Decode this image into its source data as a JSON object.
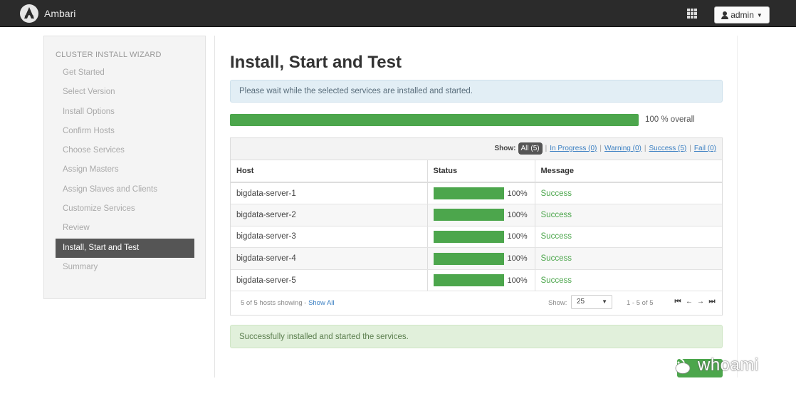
{
  "navbar": {
    "app_name": "Ambari",
    "user_label": "admin"
  },
  "sidebar": {
    "title": "CLUSTER INSTALL WIZARD",
    "items": [
      {
        "label": "Get Started"
      },
      {
        "label": "Select Version"
      },
      {
        "label": "Install Options"
      },
      {
        "label": "Confirm Hosts"
      },
      {
        "label": "Choose Services"
      },
      {
        "label": "Assign Masters"
      },
      {
        "label": "Assign Slaves and Clients"
      },
      {
        "label": "Customize Services"
      },
      {
        "label": "Review"
      },
      {
        "label": "Install, Start and Test",
        "active": true
      },
      {
        "label": "Summary"
      }
    ]
  },
  "main": {
    "title": "Install, Start and Test",
    "info_message": "Please wait while the selected services are installed and started.",
    "overall_progress": 100,
    "overall_label": "100 % overall",
    "filters": {
      "show_label": "Show:",
      "all": "All (5)",
      "in_progress": "In Progress (0)",
      "warning": "Warning (0)",
      "success": "Success (5)",
      "fail": "Fail (0)"
    },
    "table": {
      "headers": {
        "host": "Host",
        "status": "Status",
        "message": "Message"
      },
      "rows": [
        {
          "host": "bigdata-server-1",
          "progress": 100,
          "pct": "100%",
          "message": "Success"
        },
        {
          "host": "bigdata-server-2",
          "progress": 100,
          "pct": "100%",
          "message": "Success"
        },
        {
          "host": "bigdata-server-3",
          "progress": 100,
          "pct": "100%",
          "message": "Success"
        },
        {
          "host": "bigdata-server-4",
          "progress": 100,
          "pct": "100%",
          "message": "Success"
        },
        {
          "host": "bigdata-server-5",
          "progress": 100,
          "pct": "100%",
          "message": "Success"
        }
      ]
    },
    "footer": {
      "count_text": "5 of 5 hosts showing - ",
      "show_all": "Show All",
      "show_label": "Show:",
      "page_size": "25",
      "range": "1 - 5 of 5"
    },
    "success_message": "Successfully installed and started the services."
  },
  "watermark": {
    "text": "whoami"
  },
  "colors": {
    "navbar_bg": "#2b2b2b",
    "progress_green": "#4ca64c",
    "link_blue": "#3a7fc2",
    "sidebar_active_bg": "#555555"
  }
}
